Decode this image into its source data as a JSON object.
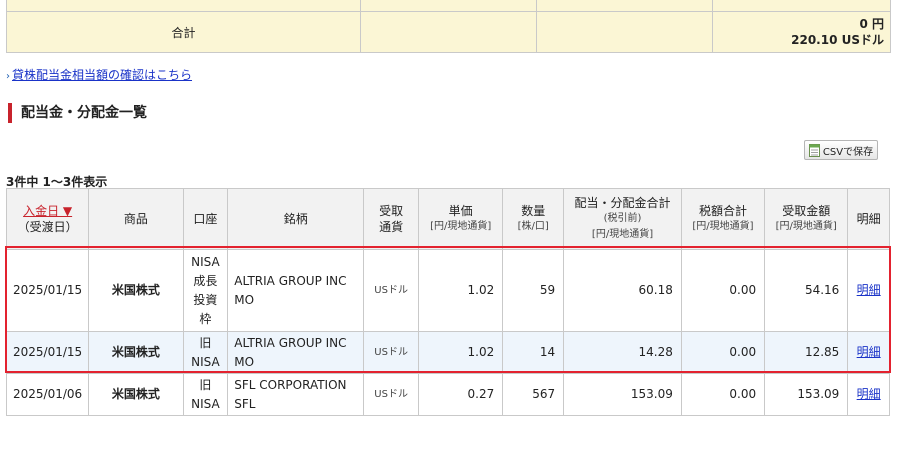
{
  "total": {
    "label": "合計",
    "jpy": "0 円",
    "usd": "220.10 USドル"
  },
  "link": {
    "text": "貸株配当金相当額の確認はこちら"
  },
  "section_title": "配当金・分配金一覧",
  "csv_button": "CSVで保存",
  "count_text": "3件中 1〜3件表示",
  "headers": {
    "date": "入金日 ▼",
    "date_sub": "（受渡日）",
    "product": "商品",
    "account": "口座",
    "name": "銘柄",
    "currency_1": "受取",
    "currency_2": "通貨",
    "unit_price": "単価",
    "unit_price_sub": "[円/現地通貨]",
    "quantity": "数量",
    "quantity_sub": "[株/口]",
    "total": "配当・分配金合計",
    "total_sub1": "(税引前)",
    "total_sub2": "[円/現地通貨]",
    "tax": "税額合計",
    "tax_sub": "[円/現地通貨]",
    "received": "受取金額",
    "received_sub": "[円/現地通貨]",
    "detail": "明細"
  },
  "rows": [
    {
      "date": "2025/01/15",
      "product": "米国株式",
      "account_lines": [
        "NISA",
        "成長",
        "投資",
        "枠"
      ],
      "name_1": "ALTRIA GROUP INC",
      "name_2": "MO",
      "currency": "USドル",
      "unit_price": "1.02",
      "quantity": "59",
      "total": "60.18",
      "tax": "0.00",
      "received": "54.16",
      "detail": "明細"
    },
    {
      "date": "2025/01/15",
      "product": "米国株式",
      "account_lines": [
        "旧",
        "NISA"
      ],
      "name_1": "ALTRIA GROUP INC",
      "name_2": "MO",
      "currency": "USドル",
      "unit_price": "1.02",
      "quantity": "14",
      "total": "14.28",
      "tax": "0.00",
      "received": "12.85",
      "detail": "明細"
    },
    {
      "date": "2025/01/06",
      "product": "米国株式",
      "account_lines": [
        "旧",
        "NISA"
      ],
      "name_1": "SFL CORPORATION",
      "name_2": "SFL",
      "currency": "USドル",
      "unit_price": "0.27",
      "quantity": "567",
      "total": "153.09",
      "tax": "0.00",
      "received": "153.09",
      "detail": "明細"
    }
  ],
  "colors": {
    "highlight": "#e3222f",
    "link": "#1a33c8",
    "accent": "#c8232c",
    "total_bg": "#fbf6d5"
  }
}
